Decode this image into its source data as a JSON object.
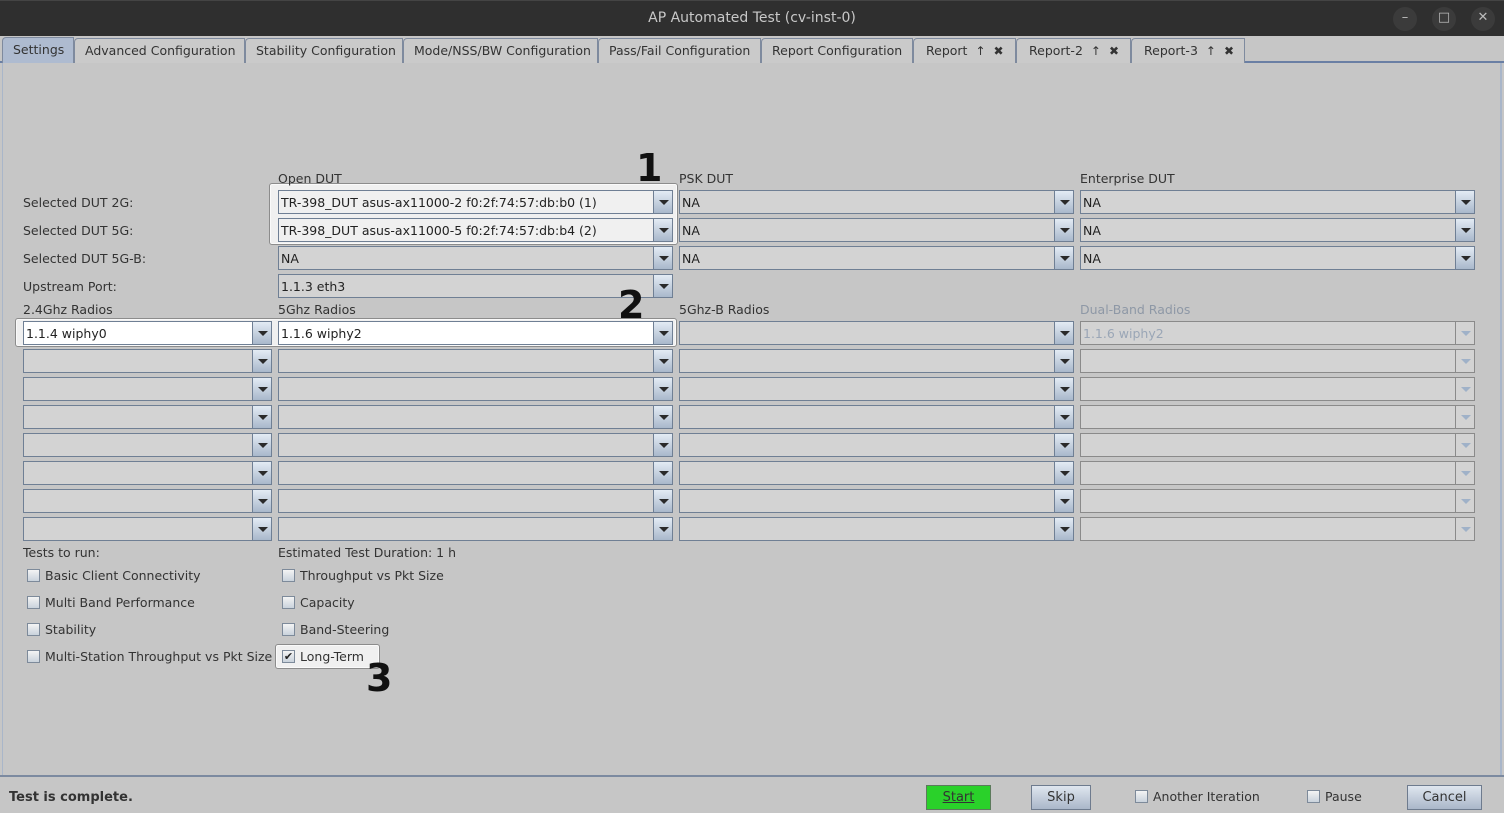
{
  "window": {
    "title": "AP Automated Test  (cv-inst-0)",
    "controls": {
      "minimize": "–",
      "maximize": "□",
      "close": "✕"
    }
  },
  "tabs": [
    {
      "label": "Settings",
      "active": true
    },
    {
      "label": "Advanced Configuration"
    },
    {
      "label": "Stability Configuration"
    },
    {
      "label": "Mode/NSS/BW Configuration"
    },
    {
      "label": "Pass/Fail Configuration"
    },
    {
      "label": "Report Configuration"
    },
    {
      "label": "Report",
      "pop_icon": "↑",
      "close_icon": "✖"
    },
    {
      "label": "Report-2",
      "pop_icon": "↑",
      "close_icon": "✖"
    },
    {
      "label": "Report-3",
      "pop_icon": "↑",
      "close_icon": "✖"
    }
  ],
  "dut": {
    "column_headers": {
      "open": "Open DUT",
      "psk": "PSK DUT",
      "enterprise": "Enterprise DUT"
    },
    "rows": [
      {
        "label": "Selected DUT 2G:",
        "open": "TR-398_DUT asus-ax11000-2 f0:2f:74:57:db:b0 (1)",
        "psk": "NA",
        "enterprise": "NA"
      },
      {
        "label": "Selected DUT 5G:",
        "open": "TR-398_DUT asus-ax11000-5 f0:2f:74:57:db:b4 (2)",
        "psk": "NA",
        "enterprise": "NA"
      },
      {
        "label": "Selected DUT 5G-B:",
        "open": "NA",
        "psk": "NA",
        "enterprise": "NA"
      }
    ],
    "upstream": {
      "label": "Upstream Port:",
      "value": "1.1.3 eth3"
    }
  },
  "radios": {
    "headers": {
      "r24": "2.4Ghz Radios",
      "r5": "5Ghz Radios",
      "r5b": "5Ghz-B Radios",
      "dual": "Dual-Band Radios"
    },
    "rows": [
      {
        "r24": "1.1.4 wiphy0",
        "r5": "1.1.6 wiphy2",
        "r5b": "",
        "dual": "1.1.6 wiphy2"
      },
      {
        "r24": "",
        "r5": "",
        "r5b": "",
        "dual": ""
      },
      {
        "r24": "",
        "r5": "",
        "r5b": "",
        "dual": ""
      },
      {
        "r24": "",
        "r5": "",
        "r5b": "",
        "dual": ""
      },
      {
        "r24": "",
        "r5": "",
        "r5b": "",
        "dual": ""
      },
      {
        "r24": "",
        "r5": "",
        "r5b": "",
        "dual": ""
      },
      {
        "r24": "",
        "r5": "",
        "r5b": "",
        "dual": ""
      },
      {
        "r24": "",
        "r5": "",
        "r5b": "",
        "dual": ""
      }
    ]
  },
  "tests": {
    "label": "Tests to run:",
    "duration": "Estimated Test Duration: 1 h",
    "left": [
      {
        "label": "Basic Client Connectivity",
        "checked": false
      },
      {
        "label": "Multi Band Performance",
        "checked": false
      },
      {
        "label": "Stability",
        "checked": false
      },
      {
        "label": "Multi-Station Throughput vs Pkt Size",
        "checked": false
      }
    ],
    "right": [
      {
        "label": "Throughput vs Pkt Size",
        "checked": false
      },
      {
        "label": "Capacity",
        "checked": false
      },
      {
        "label": "Band-Steering",
        "checked": false
      },
      {
        "label": "Long-Term",
        "checked": true
      }
    ]
  },
  "annotations": {
    "m1": "1",
    "m2": "2",
    "m3": "3"
  },
  "status": {
    "text": "Test is complete.",
    "start": "Start",
    "skip": "Skip",
    "another_iteration": "Another Iteration",
    "pause": "Pause",
    "cancel": "Cancel",
    "start_color": "#2ad12a"
  }
}
